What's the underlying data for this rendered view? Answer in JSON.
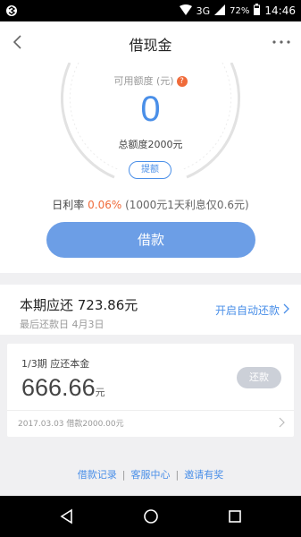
{
  "status_bar": {
    "network": "3G",
    "battery": "72%",
    "time": "14:46"
  },
  "nav": {
    "title": "借现金"
  },
  "quota": {
    "available_label": "可用额度 (元)",
    "help_icon": "?",
    "available_value": "0",
    "total": "总额度2000元",
    "raise_label": "提额"
  },
  "rate": {
    "prefix": "日利率",
    "value": "0.06%",
    "note": "(1000元1天利息仅0.6元)"
  },
  "borrow_button": "借款",
  "repay": {
    "title": "本期应还 723.86元",
    "due": "最后还款日 4月3日",
    "auto_repay": "开启自动还款"
  },
  "period": {
    "label": "1/3期 应还本金",
    "amount": "666.66",
    "unit": "元",
    "repay_button": "还款",
    "loan_record": "2017.03.03 借款2000.00元"
  },
  "footer": {
    "links": [
      "借款记录",
      "客服中心",
      "邀请有奖"
    ],
    "separator": "|"
  },
  "colors": {
    "accent": "#4a8fe8",
    "rate": "#f06b3a",
    "button": "#6c9ee6"
  }
}
